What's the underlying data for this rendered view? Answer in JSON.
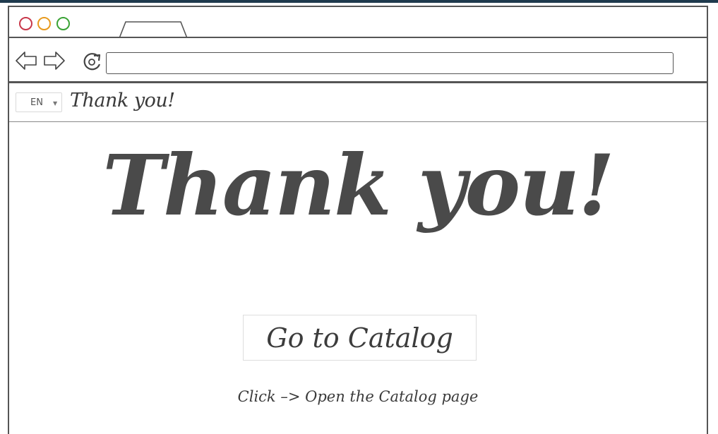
{
  "browser": {
    "window_controls": [
      "close",
      "minimize",
      "maximize"
    ],
    "url": ""
  },
  "toolbar": {
    "language": "EN",
    "page_title": "Thank you!"
  },
  "content": {
    "heading": "Thank you!",
    "button_label": "Go to Catalog",
    "note": "Click –> Open the Catalog page"
  },
  "icons": {
    "back": "arrow-left-icon",
    "forward": "arrow-right-icon",
    "reload": "reload-icon",
    "dropdown": "caret-down-icon"
  },
  "colors": {
    "close": "#c8384a",
    "minimize": "#e89a1d",
    "maximize": "#3aa335",
    "text": "#444444"
  }
}
